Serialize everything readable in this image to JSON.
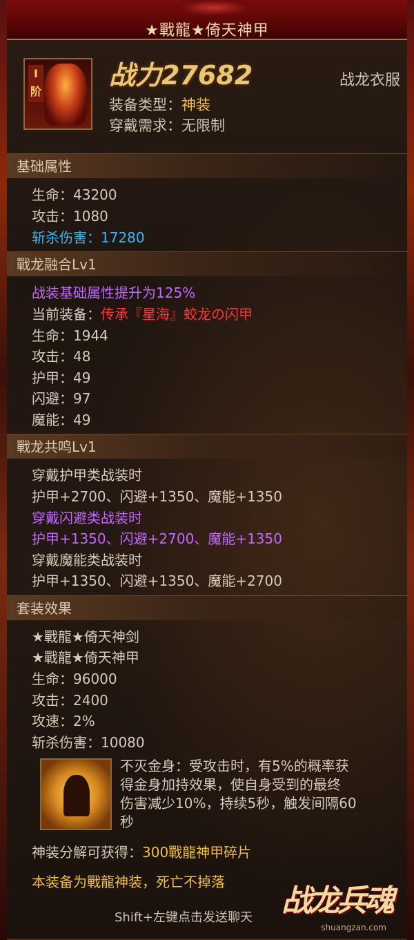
{
  "header": {
    "title": "★戰龍★倚天神甲"
  },
  "item": {
    "tier_label": "I 阶",
    "power_label": "战力27682",
    "kind": "战龙衣服",
    "type_label": "装备类型：",
    "type_value": "神装",
    "requirement": "穿戴需求：无限制"
  },
  "base": {
    "heading": "基础属性",
    "hp": "生命：43200",
    "atk": "攻击：1080",
    "slash_label": "斩杀伤害：",
    "slash_value": "17280"
  },
  "fusion": {
    "heading": "戰龙融合Lv1",
    "boost": "战装基础属性提升为125%",
    "current_label": "当前装备：",
    "current_value": "传承『星海』蛟龙の闪甲",
    "hp": "生命：1944",
    "atk": "攻击：48",
    "armor": "护甲：49",
    "dodge": "闪避：97",
    "magic": "魔能：49"
  },
  "resonance": {
    "heading": "戰龙共鸣Lv1",
    "armor_title": "穿戴护甲类战装时",
    "armor_stats": "护甲+2700、闪避+1350、魔能+1350",
    "dodge_title": "穿戴闪避类战装时",
    "dodge_stats": "护甲+1350、闪避+2700、魔能+1350",
    "magic_title": "穿戴魔能类战装时",
    "magic_stats": "护甲+1350、闪避+1350、魔能+2700"
  },
  "set": {
    "heading": "套装效果",
    "piece1": "★戰龍★倚天神剑",
    "piece2": "★戰龍★倚天神甲",
    "hp": "生命：96000",
    "atk": "攻击：2400",
    "speed": "攻速：2%",
    "slash": "斩杀伤害：10080",
    "skill_line1": "不灭金身：受攻击时，有5%的概率获",
    "skill_line2": "得金身加持效果，使自身受到的最终",
    "skill_line3": "伤害减少10%，持续5秒，触发间隔60",
    "skill_line4": "秒"
  },
  "decompose": {
    "label": "神装分解可获得：",
    "value": "300戰龍神甲碎片"
  },
  "notice": "本装备为戰龍神装，死亡不掉落",
  "footer": {
    "hint": "Shift+左键点击发送聊天",
    "logo": "战龙兵魂",
    "watermark": "shuangzan.com"
  },
  "icons": {
    "equipment": "armor-icon",
    "skill": "golden-body-icon"
  }
}
